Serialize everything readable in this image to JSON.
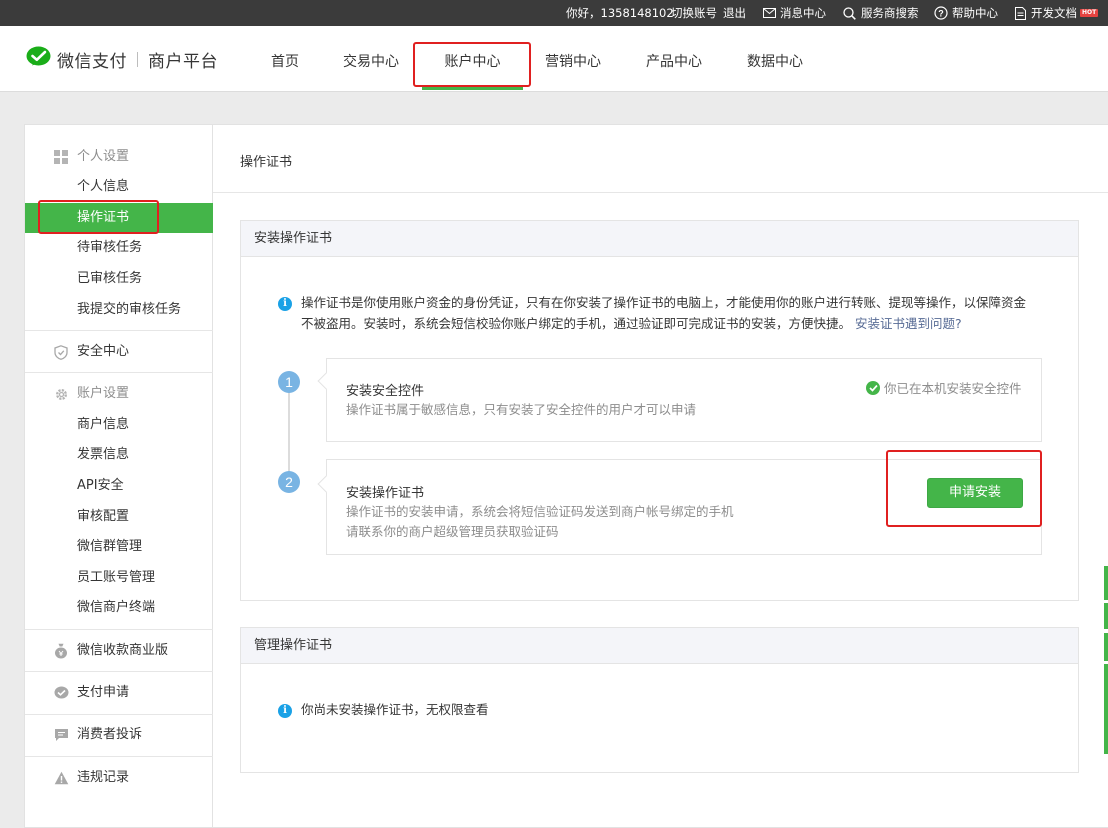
{
  "topbar": {
    "greeting": "你好，1358148102",
    "switch_account": "切换账号",
    "logout": "退出",
    "messages": "消息中心",
    "provider_search": "服务商搜索",
    "help": "帮助中心",
    "dev_docs": "开发文档",
    "hot_badge": "HOT"
  },
  "header": {
    "logo_brand": "微信支付",
    "logo_platform": "商户平台",
    "nav": [
      {
        "label": "首页"
      },
      {
        "label": "交易中心"
      },
      {
        "label": "账户中心",
        "active": true
      },
      {
        "label": "营销中心"
      },
      {
        "label": "产品中心"
      },
      {
        "label": "数据中心"
      }
    ]
  },
  "sidebar": {
    "personal_settings": "个人设置",
    "personal_items": [
      "个人信息",
      "操作证书",
      "待审核任务",
      "已审核任务",
      "我提交的审核任务"
    ],
    "security_center": "安全中心",
    "account_settings": "账户设置",
    "account_items": [
      "商户信息",
      "发票信息",
      "API安全",
      "审核配置",
      "微信群管理",
      "员工账号管理",
      "微信商户终端"
    ],
    "business_edition": "微信收款商业版",
    "payment_apply": "支付申请",
    "consumer_complaint": "消费者投诉",
    "violation_record": "违规记录"
  },
  "content": {
    "title": "操作证书",
    "install_card": {
      "title": "安装操作证书",
      "desc_line1": "操作证书是你使用账户资金的身份凭证，只有在你安装了操作证书的电脑上，才能使用你的账户进行转账、提现等操作，以保障资金",
      "desc_line2": "不被盗用。安装时，系统会短信校验你账户绑定的手机，通过验证即可完成证书的安装，方便快捷。",
      "help_link": "安装证书遇到问题?",
      "step1": {
        "num": "1",
        "title": "安装安全控件",
        "sub": "操作证书属于敏感信息，只有安装了安全控件的用户才可以申请",
        "status": "你已在本机安装安全控件"
      },
      "step2": {
        "num": "2",
        "title": "安装操作证书",
        "sub1": "操作证书的安装申请，系统会将短信验证码发送到商户帐号绑定的手机",
        "sub2": "请联系你的商户超级管理员获取验证码",
        "button": "申请安装"
      }
    },
    "manage_card": {
      "title": "管理操作证书",
      "notice": "你尚未安装操作证书，无权限查看"
    }
  },
  "colors": {
    "brand_green": "#44b549",
    "highlight_red": "#e02020",
    "topbar_bg": "#3b3b3b",
    "link_blue": "#576b95",
    "info_blue": "#1aa1e6",
    "step_blue": "#79b4e3"
  }
}
